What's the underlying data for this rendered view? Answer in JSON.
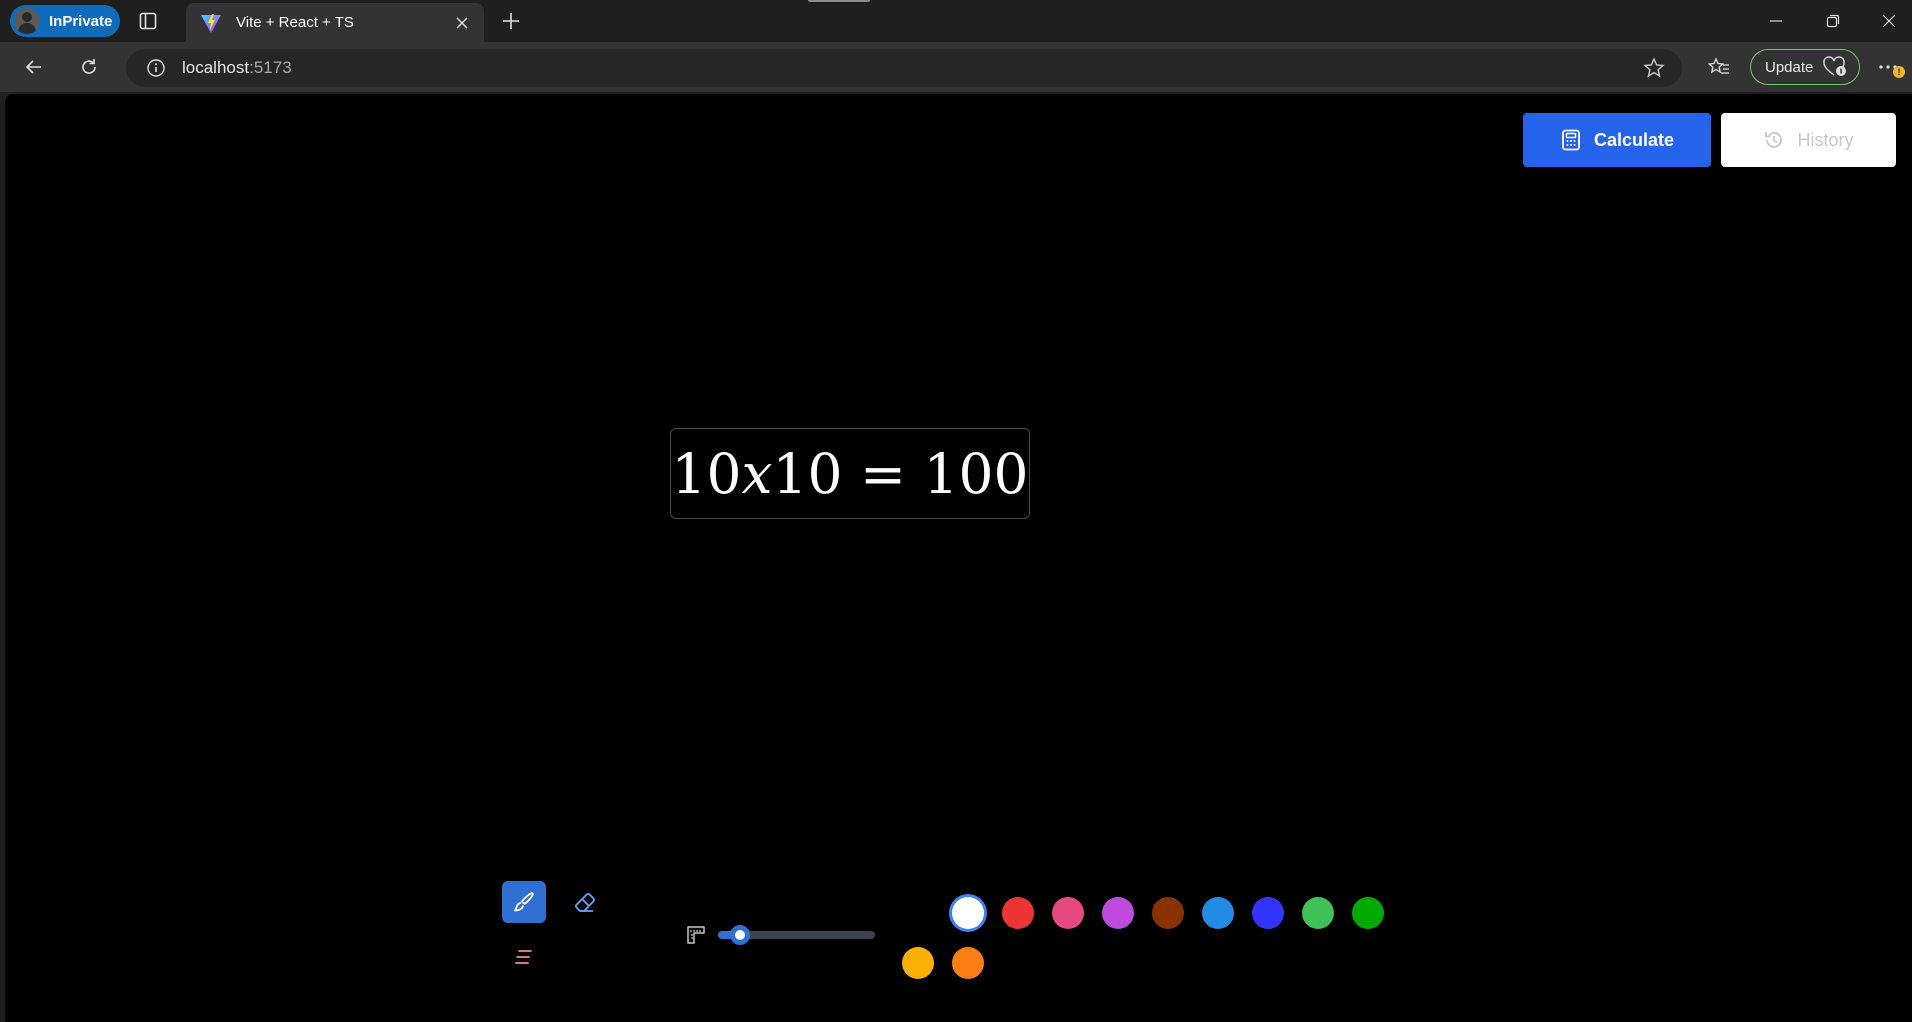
{
  "browser": {
    "inprivate_label": "InPrivate",
    "tab_title": "Vite + React + TS",
    "address_host": "localhost",
    "address_port": ":5173",
    "update_label": "Update",
    "more_badge": "!"
  },
  "app": {
    "calculate_label": "Calculate",
    "history_label": "History",
    "result_expr_a": "10",
    "result_expr_var": "x",
    "result_expr_b": "10 = 100",
    "brush_size": 0.14,
    "colors": [
      {
        "hex": "#000000",
        "row": 0,
        "col": 0
      },
      {
        "hex": "#ffffff",
        "row": 0,
        "col": 1,
        "selected": true
      },
      {
        "hex": "#ee3535",
        "row": 0,
        "col": 2
      },
      {
        "hex": "#e64980",
        "row": 0,
        "col": 3
      },
      {
        "hex": "#be4bdb",
        "row": 0,
        "col": 4
      },
      {
        "hex": "#893200",
        "row": 0,
        "col": 5
      },
      {
        "hex": "#228be6",
        "row": 0,
        "col": 6
      },
      {
        "hex": "#3333ff",
        "row": 0,
        "col": 7
      },
      {
        "hex": "#40c057",
        "row": 0,
        "col": 8
      },
      {
        "hex": "#00aa00",
        "row": 0,
        "col": 9
      },
      {
        "hex": "#fab005",
        "row": 1,
        "col": 0
      },
      {
        "hex": "#fd7e14",
        "row": 1,
        "col": 1
      }
    ]
  }
}
